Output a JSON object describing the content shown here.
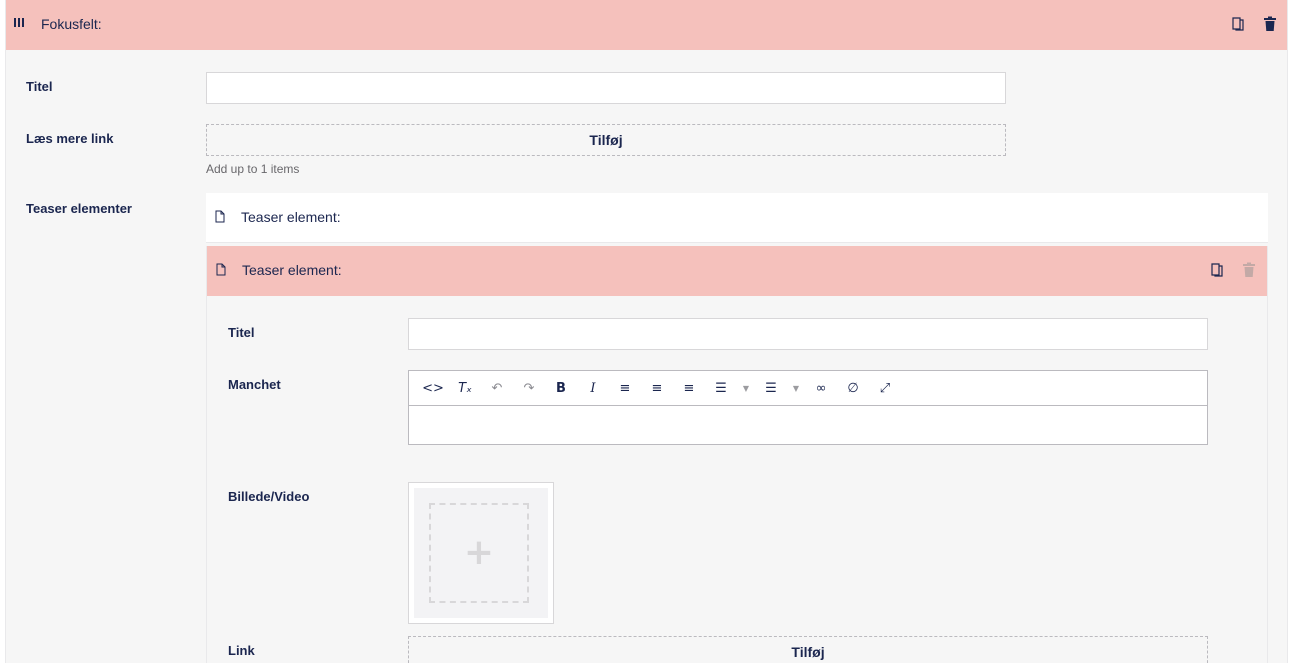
{
  "outer_block": {
    "title": "Fokusfelt:",
    "fields": {
      "titel_label": "Titel",
      "titel_value": "",
      "laes_mere_label": "Læs mere link",
      "laes_mere_button": "Tilføj",
      "laes_mere_hint": "Add up to 1 items",
      "teaser_label": "Teaser elementer"
    }
  },
  "teaser_elements": [
    {
      "title": "Teaser element:"
    },
    {
      "title": "Teaser element:"
    }
  ],
  "teaser_open": {
    "titel_label": "Titel",
    "titel_value": "",
    "manchet_label": "Manchet",
    "billede_label": "Billede/Video",
    "link_label": "Link",
    "link_button": "Tilføj"
  },
  "toolbar": {
    "source": "<>",
    "clear": "Tₓ",
    "undo": "↶",
    "redo": "↷",
    "bold": "B",
    "italic": "I",
    "align_left": "≡",
    "align_center": "≡",
    "align_right": "≡",
    "bullet_list": "☰",
    "number_list": "☰",
    "caret": "▼",
    "link": "∞",
    "unlink": "∅",
    "fullscreen": "⤢"
  },
  "media": {
    "add_symbol": "+"
  },
  "colors": {
    "header_pink": "#f5c1bc",
    "text": "#1b264f",
    "panel": "#f6f6f6"
  }
}
